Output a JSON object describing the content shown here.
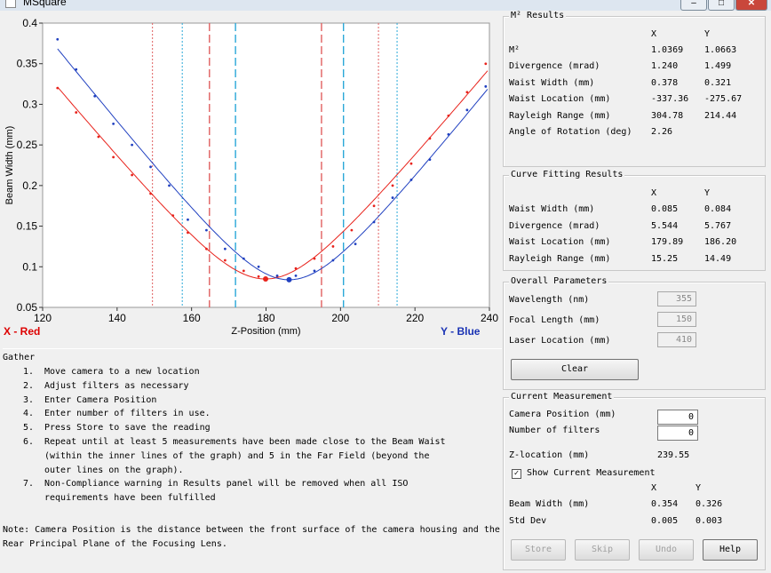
{
  "window": {
    "title": "MSquare",
    "min_label": "–",
    "max_label": "□",
    "close_label": "✕"
  },
  "chart_data": {
    "type": "scatter",
    "xlabel": "Z-Position (mm)",
    "ylabel": "Beam Width (mm)",
    "xlim": [
      120,
      240
    ],
    "ylim": [
      0.05,
      0.4
    ],
    "xticks": [
      120,
      140,
      160,
      180,
      200,
      220,
      240
    ],
    "yticks": [
      0.05,
      0.1,
      0.15,
      0.2,
      0.25,
      0.3,
      0.35,
      0.4
    ],
    "ytick_labels": [
      "0.05",
      "0.1",
      "0.15",
      "0.2",
      "0.25",
      "0.3",
      "0.35",
      "0.4"
    ],
    "grid": false,
    "legend_left": "X - Red",
    "legend_right": "Y - Blue",
    "series": [
      {
        "color": "#e8221b",
        "points": [
          [
            124,
            0.32
          ],
          [
            129,
            0.29
          ],
          [
            135,
            0.26
          ],
          [
            139,
            0.235
          ],
          [
            144,
            0.213
          ],
          [
            149,
            0.19
          ],
          [
            155,
            0.163
          ],
          [
            159,
            0.142
          ],
          [
            164,
            0.122
          ],
          [
            169,
            0.108
          ],
          [
            174,
            0.095
          ],
          [
            178,
            0.088
          ],
          [
            183,
            0.088
          ],
          [
            188,
            0.098
          ],
          [
            193,
            0.11
          ],
          [
            198,
            0.125
          ],
          [
            203,
            0.145
          ],
          [
            209,
            0.175
          ],
          [
            214,
            0.2
          ],
          [
            219,
            0.227
          ],
          [
            224,
            0.258
          ],
          [
            229,
            0.286
          ],
          [
            234,
            0.315
          ],
          [
            239,
            0.35
          ]
        ],
        "waist": [
          179.89,
          0.085
        ],
        "divergence": 5.544,
        "rayleigh": 15.25
      },
      {
        "color": "#2040c0",
        "points": [
          [
            124,
            0.38
          ],
          [
            129,
            0.343
          ],
          [
            134,
            0.31
          ],
          [
            139,
            0.276
          ],
          [
            144,
            0.25
          ],
          [
            149,
            0.223
          ],
          [
            154,
            0.2
          ],
          [
            159,
            0.158
          ],
          [
            164,
            0.145
          ],
          [
            169,
            0.122
          ],
          [
            174,
            0.11
          ],
          [
            178,
            0.1
          ],
          [
            183,
            0.089
          ],
          [
            188,
            0.089
          ],
          [
            193,
            0.095
          ],
          [
            198,
            0.108
          ],
          [
            204,
            0.128
          ],
          [
            209,
            0.155
          ],
          [
            214,
            0.185
          ],
          [
            219,
            0.207
          ],
          [
            224,
            0.232
          ],
          [
            229,
            0.263
          ],
          [
            234,
            0.293
          ],
          [
            239,
            0.322
          ]
        ],
        "waist": [
          186.2,
          0.084
        ],
        "divergence": 5.767,
        "rayleigh": 14.49
      }
    ],
    "vlines": [
      {
        "x": 149.5,
        "color": "#e06060",
        "style": "dot"
      },
      {
        "x": 157.5,
        "color": "#2aa8d8",
        "style": "dot"
      },
      {
        "x": 164.8,
        "color": "#e06060",
        "style": "dash"
      },
      {
        "x": 171.8,
        "color": "#2aa8d8",
        "style": "dash"
      },
      {
        "x": 194.9,
        "color": "#e06060",
        "style": "dash"
      },
      {
        "x": 200.8,
        "color": "#2aa8d8",
        "style": "dash"
      },
      {
        "x": 210.2,
        "color": "#e06060",
        "style": "dot"
      },
      {
        "x": 215.2,
        "color": "#2aa8d8",
        "style": "dot"
      }
    ]
  },
  "instructions": {
    "title": "Gather",
    "items": [
      {
        "n": "1.",
        "text": "Move camera to a new location"
      },
      {
        "n": "2.",
        "text": "Adjust filters as necessary"
      },
      {
        "n": "3.",
        "text": "Enter Camera Position"
      },
      {
        "n": "4.",
        "text": "Enter number of filters in use."
      },
      {
        "n": "5.",
        "text": "Press Store to save the reading"
      },
      {
        "n": "6.",
        "text": "Repeat until at least 5 measurements have been made close to the Beam Waist"
      },
      {
        "n": "",
        "text": "(within the inner lines of the graph) and 5 in the Far Field (beyond the"
      },
      {
        "n": "",
        "text": "outer lines on the graph)."
      },
      {
        "n": "7.",
        "text": "Non-Compliance warning in Results panel will be removed when all ISO"
      },
      {
        "n": "",
        "text": "requirements have been fulfilled"
      }
    ],
    "note1": "Note: Camera Position is the distance between the front surface of the camera housing and the",
    "note2": "Rear Principal Plane of the Focusing Lens."
  },
  "m2_results": {
    "title": "M² Results",
    "col_x": "X",
    "col_y": "Y",
    "rows": [
      {
        "label": "M²",
        "x": "1.0369",
        "y": "1.0663"
      },
      {
        "label": "Divergence (mrad)",
        "x": "1.240",
        "y": "1.499"
      },
      {
        "label": "Waist Width (mm)",
        "x": "0.378",
        "y": "0.321"
      },
      {
        "label": "Waist Location (mm)",
        "x": "-337.36",
        "y": "-275.67"
      },
      {
        "label": "Rayleigh Range (mm)",
        "x": "304.78",
        "y": "214.44"
      },
      {
        "label": "Angle of Rotation (deg)",
        "x": "2.26",
        "y": ""
      }
    ]
  },
  "curve_fit": {
    "title": "Curve Fitting Results",
    "col_x": "X",
    "col_y": "Y",
    "rows": [
      {
        "label": "Waist Width (mm)",
        "x": "0.085",
        "y": "0.084"
      },
      {
        "label": "Divergence (mrad)",
        "x": "5.544",
        "y": "5.767"
      },
      {
        "label": "Waist Location (mm)",
        "x": "179.89",
        "y": "186.20"
      },
      {
        "label": "Rayleigh Range (mm)",
        "x": "15.25",
        "y": "14.49"
      }
    ]
  },
  "overall": {
    "title": "Overall Parameters",
    "wavelength_label": "Wavelength (nm)",
    "wavelength_value": "355",
    "focal_label": "Focal Length (mm)",
    "focal_value": "150",
    "laser_label": "Laser Location (mm)",
    "laser_value": "410",
    "clear_label": "Clear"
  },
  "current": {
    "title": "Current Measurement",
    "camera_label": "Camera Position (mm)",
    "camera_value": "0",
    "filters_label": "Number of filters",
    "filters_value": "0",
    "zloc_label": "Z-location (mm)",
    "zloc_value": "239.55",
    "show_label": "Show Current Measurement",
    "show_check": "✓",
    "col_x": "X",
    "col_y": "Y",
    "beam_label": "Beam Width (mm)",
    "beam_x": "0.354",
    "beam_y": "0.326",
    "std_label": "Std Dev",
    "std_x": "0.005",
    "std_y": "0.003"
  },
  "buttons": {
    "store": "Store",
    "skip": "Skip",
    "undo": "Undo",
    "help": "Help"
  }
}
